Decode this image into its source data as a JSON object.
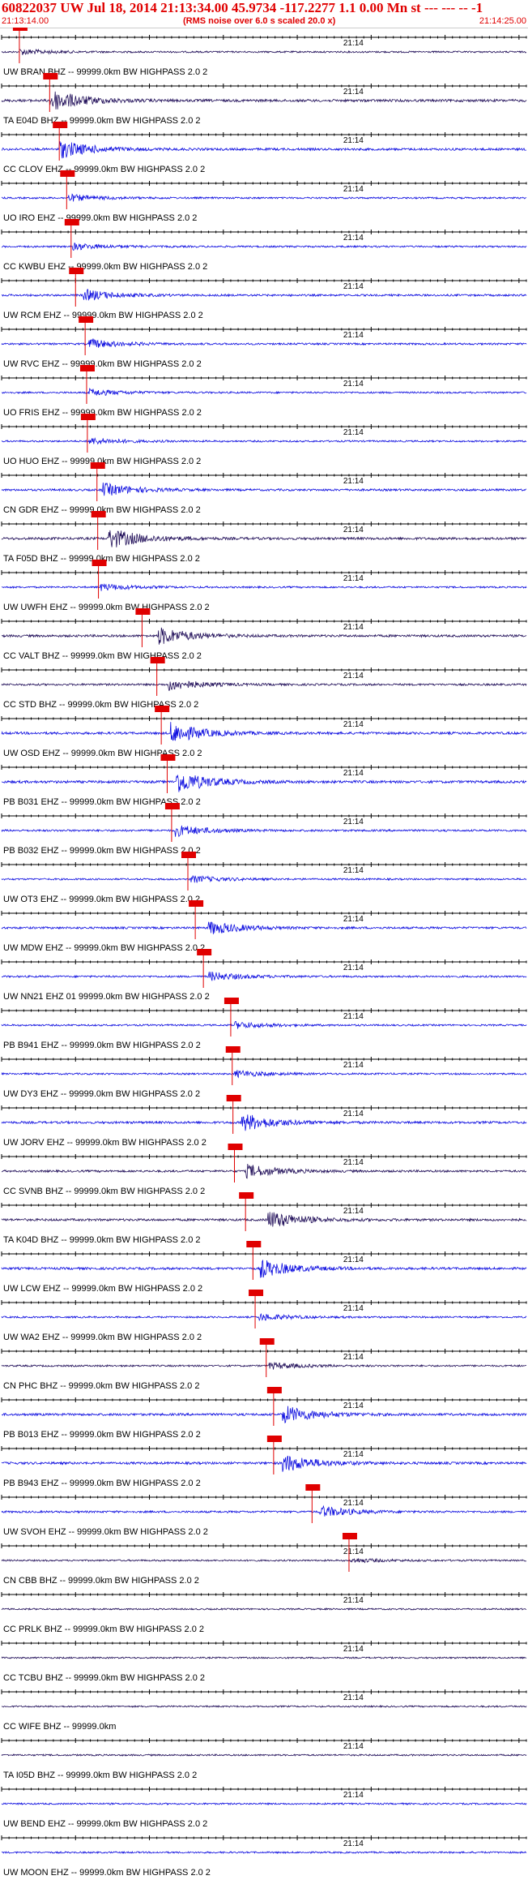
{
  "header": {
    "title": "60822037 UW Jul 18, 2014 21:13:34.00   45.9734 -117.2277  1.1 0.00 Mn st --- --- -- -1",
    "subtitle": "(RMS noise over 6.0 s scaled 20.0 x)",
    "start_time": "21:13:14.00",
    "end_time": "21:14:25.00"
  },
  "colors": {
    "trace_blue": "#1010e0",
    "trace_dark": "#22105a",
    "pick_red": "#e00000",
    "tick": "#000000"
  },
  "chart_data": {
    "type": "line",
    "minute_label": "21:14",
    "time_range_s": [
      0,
      71
    ],
    "minute_mark_s": 46,
    "channels": [
      {
        "label": "UW BRAN BHZ -- 99999.0km BW  HIGHPASS  2.0  2",
        "color": "dark",
        "pick_s": 2.4,
        "burst_s": 2.4,
        "amp": 0.25
      },
      {
        "label": "TA E04D BHZ -- 99999.0km BW  HIGHPASS  2.0  2",
        "color": "dark",
        "pick_s": 6.5,
        "burst_s": 6.5,
        "amp": 1.0
      },
      {
        "label": "CC CLOV EHZ -- 99999.0km BW  HIGHPASS  2.0  2",
        "color": "blue",
        "pick_s": 7.8,
        "burst_s": 7.8,
        "amp": 0.8
      },
      {
        "label": "UO IRO EHZ -- 99999.0km BW  HIGHPASS  2.0  2",
        "color": "blue",
        "pick_s": 8.8,
        "burst_s": 9.0,
        "amp": 0.3
      },
      {
        "label": "CC KWBU EHZ -- 99999.0km BW  HIGHPASS  2.0  2",
        "color": "blue",
        "pick_s": 9.4,
        "burst_s": 9.4,
        "amp": 0.3
      },
      {
        "label": "UW RCM EHZ -- 99999.0km BW  HIGHPASS  2.0  2",
        "color": "blue",
        "pick_s": 10.0,
        "burst_s": 11.0,
        "amp": 0.5
      },
      {
        "label": "UW RVC EHZ -- 99999.0km BW  HIGHPASS  2.0  2",
        "color": "blue",
        "pick_s": 11.3,
        "burst_s": 11.8,
        "amp": 0.4
      },
      {
        "label": "UO FRIS EHZ -- 99999.0km BW  HIGHPASS  2.0  2",
        "color": "blue",
        "pick_s": 11.5,
        "burst_s": 11.8,
        "amp": 0.3
      },
      {
        "label": "UO HUO EHZ -- 99999.0km BW  HIGHPASS  2.0  2",
        "color": "blue",
        "pick_s": 11.6,
        "burst_s": 11.8,
        "amp": 0.3
      },
      {
        "label": "CN GDR EHZ -- 99999.0km BW  HIGHPASS  2.0  2",
        "color": "blue",
        "pick_s": 12.9,
        "burst_s": 13.5,
        "amp": 0.6
      },
      {
        "label": "TA F05D BHZ -- 99999.0km BW  HIGHPASS  2.0  2",
        "color": "dark",
        "pick_s": 13.0,
        "burst_s": 14.5,
        "amp": 0.9
      },
      {
        "label": "UW UWFH EHZ -- 99999.0km BW  HIGHPASS  2.0  2",
        "color": "blue",
        "pick_s": 13.1,
        "burst_s": 13.3,
        "amp": 0.3
      },
      {
        "label": "CC VALT BHZ -- 99999.0km BW  HIGHPASS  2.0  2",
        "color": "dark",
        "pick_s": 19.0,
        "burst_s": 21.0,
        "amp": 0.8
      },
      {
        "label": "CC STD BHZ -- 99999.0km BW  HIGHPASS  2.0  2",
        "color": "dark",
        "pick_s": 21.0,
        "burst_s": 22.5,
        "amp": 0.5
      },
      {
        "label": "UW OSD EHZ -- 99999.0km BW  HIGHPASS  2.0  2",
        "color": "blue",
        "pick_s": 21.6,
        "burst_s": 22.8,
        "amp": 0.9
      },
      {
        "label": "PB B031 EHZ -- 99999.0km BW  HIGHPASS  2.0  2",
        "color": "blue",
        "pick_s": 22.4,
        "burst_s": 23.5,
        "amp": 1.0
      },
      {
        "label": "PB B032 EHZ -- 99999.0km BW  HIGHPASS  2.0  2",
        "color": "blue",
        "pick_s": 23.0,
        "burst_s": 23.5,
        "amp": 0.5
      },
      {
        "label": "UW OT3 EHZ -- 99999.0km BW  HIGHPASS  2.0  2",
        "color": "blue",
        "pick_s": 25.2,
        "burst_s": 25.6,
        "amp": 0.3
      },
      {
        "label": "UW MDW EHZ -- 99999.0km BW  HIGHPASS  2.0  2",
        "color": "blue",
        "pick_s": 26.2,
        "burst_s": 28.0,
        "amp": 0.6
      },
      {
        "label": "UW NN21 EHZ 01 99999.0km BW  HIGHPASS  2.0  2",
        "color": "blue",
        "pick_s": 27.3,
        "burst_s": 28.0,
        "amp": 0.4
      },
      {
        "label": "PB B941 EHZ -- 99999.0km BW  HIGHPASS  2.0  2",
        "color": "blue",
        "pick_s": 31.0,
        "burst_s": 31.5,
        "amp": 0.3
      },
      {
        "label": "UW DY3 EHZ -- 99999.0km BW  HIGHPASS  2.0  2",
        "color": "blue",
        "pick_s": 31.2,
        "burst_s": 31.5,
        "amp": 0.3
      },
      {
        "label": "UW JORV EHZ -- 99999.0km BW  HIGHPASS  2.0  2",
        "color": "blue",
        "pick_s": 31.3,
        "burst_s": 32.5,
        "amp": 0.8
      },
      {
        "label": "CC SVNB BHZ -- 99999.0km BW  HIGHPASS  2.0  2",
        "color": "dark",
        "pick_s": 31.5,
        "burst_s": 33.0,
        "amp": 0.6
      },
      {
        "label": "TA K04D BHZ -- 99999.0km BW  HIGHPASS  2.0  2",
        "color": "dark",
        "pick_s": 33.0,
        "burst_s": 36.0,
        "amp": 0.8
      },
      {
        "label": "UW LCW EHZ -- 99999.0km BW  HIGHPASS  2.0  2",
        "color": "blue",
        "pick_s": 34.0,
        "burst_s": 35.0,
        "amp": 0.8
      },
      {
        "label": "UW WA2 EHZ -- 99999.0km BW  HIGHPASS  2.0  2",
        "color": "blue",
        "pick_s": 34.3,
        "burst_s": 34.8,
        "amp": 0.3
      },
      {
        "label": "CN PHC BHZ -- 99999.0km BW  HIGHPASS  2.0  2",
        "color": "dark",
        "pick_s": 35.8,
        "burst_s": 36.2,
        "amp": 0.3
      },
      {
        "label": "PB B013 EHZ -- 99999.0km BW  HIGHPASS  2.0  2",
        "color": "blue",
        "pick_s": 36.8,
        "burst_s": 38.0,
        "amp": 0.8
      },
      {
        "label": "PB B943 EHZ -- 99999.0km BW  HIGHPASS  2.0  2",
        "color": "blue",
        "pick_s": 36.8,
        "burst_s": 38.0,
        "amp": 0.8
      },
      {
        "label": "UW SVOH EHZ -- 99999.0km BW  HIGHPASS  2.0  2",
        "color": "blue",
        "pick_s": 42.0,
        "burst_s": 43.0,
        "amp": 0.5
      },
      {
        "label": "CN CBB BHZ -- 99999.0km BW  HIGHPASS  2.0  2",
        "color": "dark",
        "pick_s": 47.0,
        "burst_s": 47.2,
        "amp": 0.2
      },
      {
        "label": "CC PRLK BHZ -- 99999.0km BW  HIGHPASS  2.0  2",
        "color": "dark",
        "pick_s": null,
        "burst_s": null,
        "amp": 0.15
      },
      {
        "label": "CC TCBU BHZ -- 99999.0km BW  HIGHPASS  2.0  2",
        "color": "dark",
        "pick_s": null,
        "burst_s": null,
        "amp": 0.15
      },
      {
        "label": "CC WIFE BHZ -- 99999.0km",
        "color": "dark",
        "pick_s": null,
        "burst_s": null,
        "amp": 0.15
      },
      {
        "label": "TA I05D BHZ -- 99999.0km BW  HIGHPASS  2.0  2",
        "color": "dark",
        "pick_s": null,
        "burst_s": null,
        "amp": 0.2
      },
      {
        "label": "UW BEND EHZ -- 99999.0km BW  HIGHPASS  2.0  2",
        "color": "blue",
        "pick_s": null,
        "burst_s": null,
        "amp": 0.25
      },
      {
        "label": "UW MOON EHZ -- 99999.0km BW  HIGHPASS  2.0  2",
        "color": "blue",
        "pick_s": null,
        "burst_s": null,
        "amp": 0.25
      }
    ]
  }
}
